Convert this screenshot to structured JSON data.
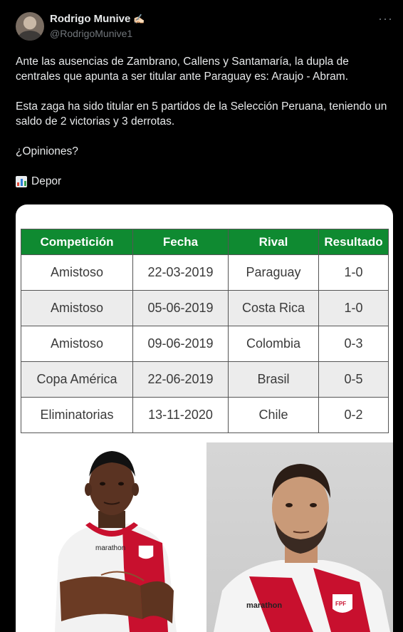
{
  "author": {
    "display_name": "Rodrigo Munive",
    "name_emoji": "✍🏻",
    "handle": "@RodrigoMunive1"
  },
  "tweet": {
    "paragraph1": "Ante las ausencias de Zambrano, Callens y Santamaría, la dupla de centrales que apunta a ser titular ante Paraguay es: Araujo - Abram.",
    "paragraph2": "Esta zaga ha sido titular en 5 partidos de la Selección Peruana, teniendo un saldo de 2 victorias y 3 derrotas.",
    "paragraph3": "¿Opiniones?",
    "source_icon": "bar-chart-icon",
    "source": "Depor"
  },
  "table": {
    "headers": [
      "Competición",
      "Fecha",
      "Rival",
      "Resultado"
    ],
    "rows": [
      [
        "Amistoso",
        "22-03-2019",
        "Paraguay",
        "1-0"
      ],
      [
        "Amistoso",
        "05-06-2019",
        "Costa Rica",
        "1-0"
      ],
      [
        "Amistoso",
        "09-06-2019",
        "Colombia",
        "0-3"
      ],
      [
        "Copa América",
        "22-06-2019",
        "Brasil",
        "0-5"
      ],
      [
        "Eliminatorias",
        "13-11-2020",
        "Chile",
        "0-2"
      ]
    ],
    "header_color": "#0f8a31"
  },
  "photos": {
    "left_shirt_text": "marathon",
    "right_shirt_text": "marathon",
    "right_crest_text": "FPF"
  }
}
